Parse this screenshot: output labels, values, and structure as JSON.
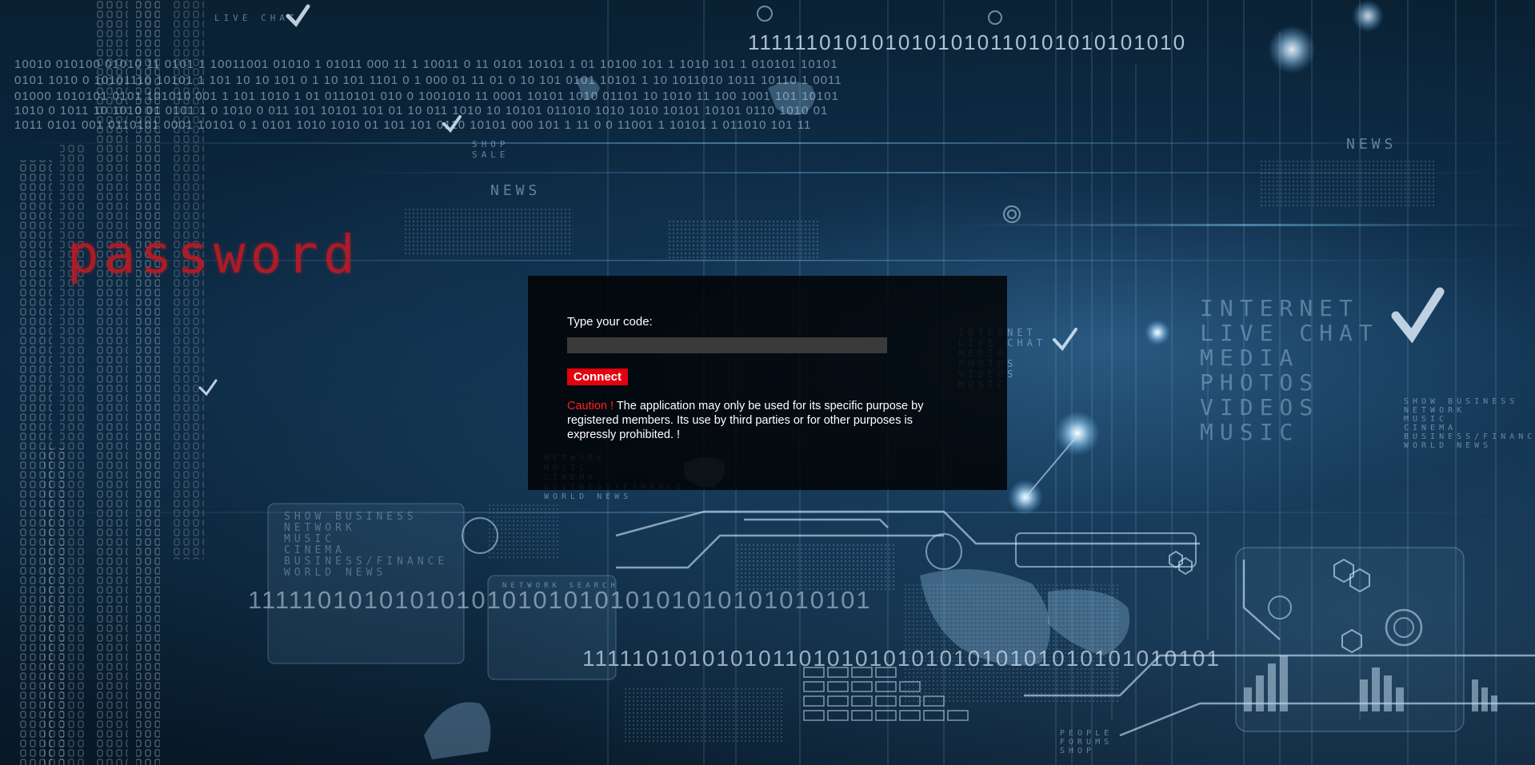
{
  "background": {
    "headline_word": "password",
    "words": {
      "news_a": "NEWS",
      "news_b": "NEWS",
      "shop_sale": "SHOP\nSALE",
      "live_chat_small": "LIVE CHAT",
      "internet_menu": "INTERNET\nLIVE CHAT\nMEDIA\nPHOTOS\nVIDEOS\nMUSIC",
      "big_menu": "INTERNET\nLIVE CHAT\nMEDIA\nPHOTOS\nVIDEOS\nMUSIC",
      "topics_right": "SHOW BUSINESS\nNETWORK\nMUSIC\nCINEMA\nBUSINESS/FINANCE\nWORLD NEWS",
      "topics_left": "SHOW BUSINESS\nNETWORK\nMUSIC\nCINEMA\nBUSINESS/FINANCE\nWORLD NEWS",
      "topics_center": "NETWORK\nMUSIC\nCINEMA\nBUSINESS/FINANCE\nWORLD NEWS",
      "network_search": "NETWORK SEARCH",
      "people_forums": "PEOPLE\nFORUMS\nSHOP"
    },
    "binary_rows": [
      "1111110101010101010110101010101010",
      "11111010101010101010101010101010101010101",
      "1111101010101011010101010101010101010101010101",
      "10010  010100  01010 11  0101 1   10011001   01010  1 01011  000 11 1    10011  0 11  0101     10101 1 01    10100  101 1    1010   101 1 010101    10101",
      "0101   1010 0   10101110   10101 1   101 10 10   101 0 1  10  101 1101  0   1 000 01 11 01 0 10 101  0101    10101  1 10    1011010     1011   10110   1 0011",
      "01000   1010101  0101   101010   001 1   101 1010  1 01   0110101   010  0  1001010  11 0001    10101   1010   01101 10   1010 11  100 1001   101    10101",
      "1010 0  1011 10  1010 01  0101 1 0   1010 0   011 101   10101   101 01  10 011   1010 10  10101   011010   1010    1010   10101    10101   0110   1010 01",
      "1011   0101  001   0110101  0001   10101 0   1 0101  1010   1010 01   101   101   0110 10101 000    101 1 11     0  0   11001 1    10101   1 011010   101 11"
    ]
  },
  "login": {
    "code_label": "Type your code:",
    "code_value": "",
    "code_placeholder": "",
    "connect_label": "Connect",
    "caution_label": "Caution !",
    "notice_text": " The application may only be used for its specific purpose by registered members. Its use by third parties or for other purposes is expressly prohibited. !"
  },
  "colors": {
    "accent": "#e3000f",
    "caution": "#ff2020",
    "panel": "#000000",
    "background": "#0a2236"
  }
}
